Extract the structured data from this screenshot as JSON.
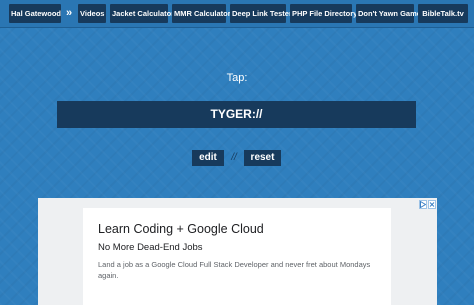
{
  "nav": {
    "items": [
      {
        "label": "Hal Gatewood"
      },
      {
        "label": "Videos"
      },
      {
        "label": "Jacket Calculator"
      },
      {
        "label": "MMR Calculator"
      },
      {
        "label": "Deep Link Tester"
      },
      {
        "label": "PHP File Directory"
      },
      {
        "label": "Don't Yawn Game"
      },
      {
        "label": "BibleTalk.tv"
      }
    ],
    "separator": "»"
  },
  "main": {
    "tap_label": "Tap:",
    "scheme": "TYGER://",
    "edit_label": "edit",
    "separator": "//",
    "reset_label": "reset"
  },
  "ad": {
    "title": "Learn Coding + Google Cloud",
    "subtitle": "No More Dead-End Jobs",
    "body": "Land a job as a Google Cloud Full Stack Developer and never fret about Mondays again.",
    "choices_icon": "adchoices-info-icon",
    "close_icon": "close-icon"
  },
  "colors": {
    "background": "#2f7fbe",
    "nav_button": "#173a5c",
    "text": "#ffffff"
  }
}
